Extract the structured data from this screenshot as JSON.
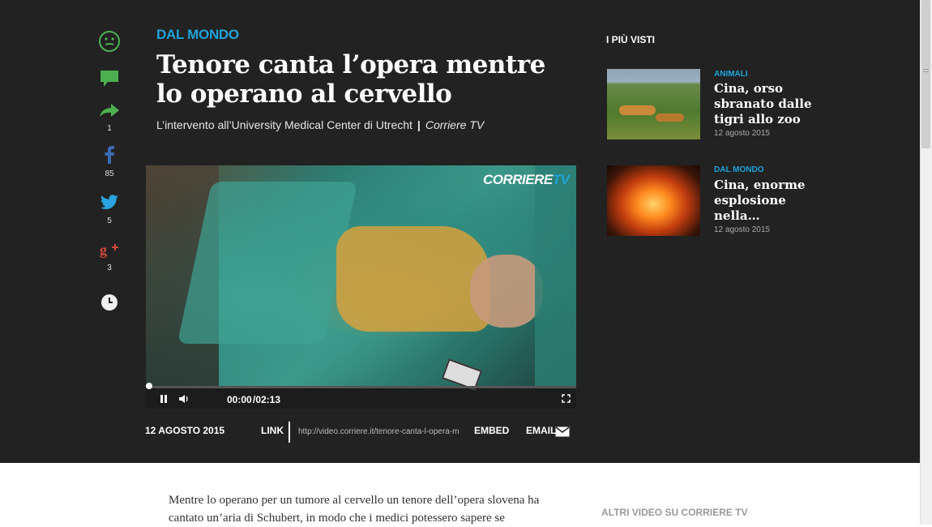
{
  "article": {
    "section": "DAL MONDO",
    "headline": "Tenore canta l’opera mentre lo operano al cervello",
    "subtitle": "L’intervento all’University Medical Center di Utrecht",
    "subtitle_separator": "|",
    "source": "Corriere TV",
    "date": "12 AGOSTO 2015",
    "body": "Mentre lo operano per un tumore al cervello un tenore dell’opera slovena ha cantato un’aria di Schubert, in modo che i medici potessero sapere se"
  },
  "social": {
    "share_count": "1",
    "facebook_count": "85",
    "twitter_count": "5",
    "gplus_count": "3"
  },
  "video": {
    "logo_main": "CORRIERE",
    "logo_tv": "TV",
    "current_time": "00:00",
    "duration": "/02:13",
    "progress": 0
  },
  "share_bar": {
    "link_label": "LINK",
    "link_url": "http://video.corriere.it/tenore-canta-l-opera-m",
    "embed_label": "EMBED",
    "email_label": "EMAIL"
  },
  "sidebar": {
    "title": "I PIÙ VISTI",
    "cards": [
      {
        "category": "ANIMALI",
        "title": "Cina, orso sbranato dalle tigri allo zoo",
        "date": "12 agosto 2015"
      },
      {
        "category": "DAL MONDO",
        "title": "Cina, enorme esplosione nella…",
        "date": "12 agosto 2015"
      }
    ],
    "more_videos": "ALTRI VIDEO SU CORRIERE TV"
  },
  "colors": {
    "accent": "#1fa3d8",
    "background_dark": "#222222"
  }
}
